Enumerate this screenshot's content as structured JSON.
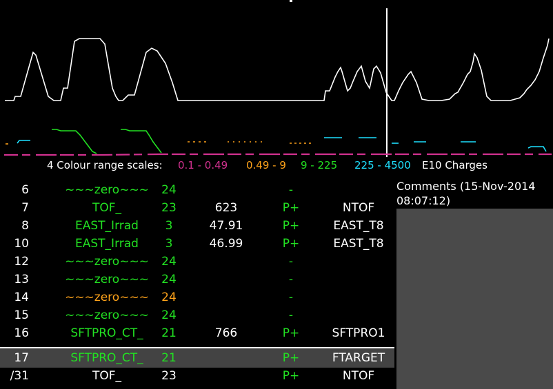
{
  "colors": {
    "green": "#22e022",
    "orange": "#ffa31a",
    "magenta": "#d2318f",
    "cyan": "#1ee0ff",
    "white": "#ffffff",
    "highlight_bg": "#434343"
  },
  "legend": {
    "prefix": "4 Colour range scales:",
    "r1": "0.1 - 0.49",
    "r2": "0.49 - 9",
    "r3": "9 - 225",
    "r4": "225 - 4500",
    "unit": "E10 Charges"
  },
  "rows": [
    {
      "num": "6",
      "name": "~~~zero~~~",
      "count": "24",
      "intensity": "",
      "particle": "-",
      "dest": "",
      "color": "green",
      "highlight": false
    },
    {
      "num": "7",
      "name": "TOF_",
      "count": "23",
      "intensity": "623",
      "particle": "P+",
      "dest": "NTOF",
      "color": "green",
      "highlight": false
    },
    {
      "num": "8",
      "name": "EAST_Irrad",
      "count": "3",
      "intensity": "47.91",
      "particle": "P+",
      "dest": "EAST_T8",
      "color": "green",
      "highlight": false
    },
    {
      "num": "10",
      "name": "EAST_Irrad",
      "count": "3",
      "intensity": "46.99",
      "particle": "P+",
      "dest": "EAST_T8",
      "color": "green",
      "highlight": false
    },
    {
      "num": "12",
      "name": "~~~zero~~~",
      "count": "24",
      "intensity": "",
      "particle": "-",
      "dest": "",
      "color": "green",
      "highlight": false
    },
    {
      "num": "13",
      "name": "~~~zero~~~",
      "count": "24",
      "intensity": "",
      "particle": "-",
      "dest": "",
      "color": "green",
      "highlight": false
    },
    {
      "num": "14",
      "name": "~~~zero~~~",
      "count": "24",
      "intensity": "",
      "particle": "-",
      "dest": "",
      "color": "orange",
      "highlight": false
    },
    {
      "num": "15",
      "name": "~~~zero~~~",
      "count": "24",
      "intensity": "",
      "particle": "-",
      "dest": "",
      "color": "green",
      "highlight": false
    },
    {
      "num": "16",
      "name": "SFTPRO_CT_",
      "count": "21",
      "intensity": "766",
      "particle": "P+",
      "dest": "SFTPRO1",
      "color": "green",
      "highlight": false
    },
    {
      "num": "17",
      "name": "SFTPRO_CT_",
      "count": "21",
      "intensity": "",
      "particle": "P+",
      "dest": "FTARGET",
      "color": "green",
      "highlight": true
    },
    {
      "num": "/31",
      "name": "TOF_",
      "count": "23",
      "intensity": "",
      "particle": "P+",
      "dest": "NTOF",
      "color": "white",
      "highlight": false
    }
  ],
  "comments": {
    "title_line1": "Comments (15-Nov-2014",
    "title_line2": "08:07:12)"
  }
}
